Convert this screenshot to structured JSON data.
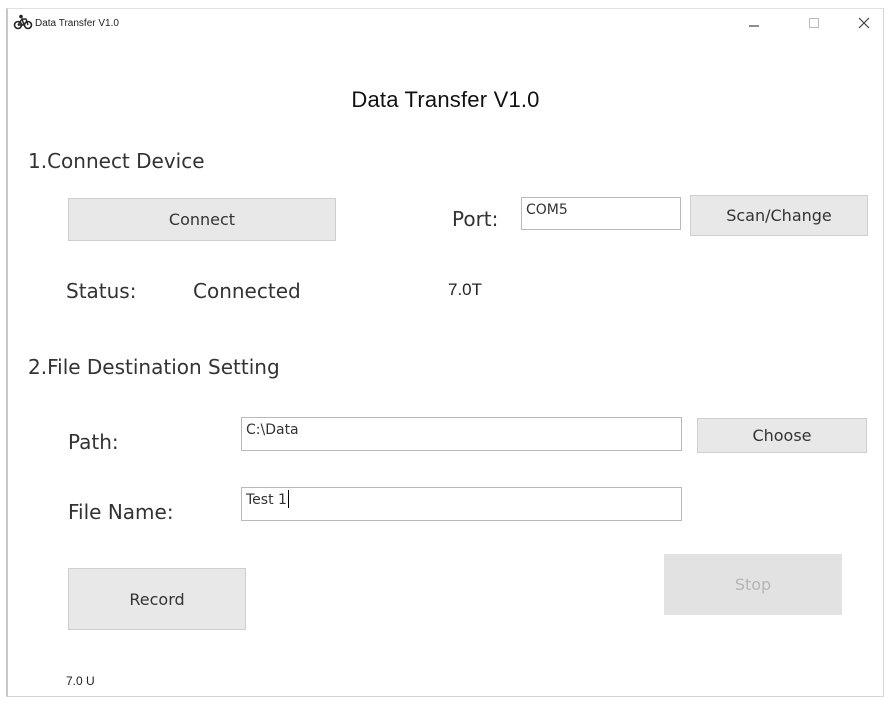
{
  "window": {
    "title": "Data Transfer V1.0",
    "icon": "bicycle-icon",
    "controls": {
      "minimize": "minimize-icon",
      "maximize": "maximize-icon",
      "close": "close-icon"
    }
  },
  "header": {
    "title": "Data Transfer V1.0"
  },
  "connect_section": {
    "title": "1.Connect Device",
    "connect_button": "Connect",
    "port_label": "Port:",
    "port_value": "COM5",
    "scan_button": "Scan/Change",
    "status_label": "Status:",
    "status_value": "Connected",
    "version_note": "7.0T"
  },
  "file_section": {
    "title": "2.File Destination Setting",
    "path_label": "Path:",
    "path_value": "C:\\Data",
    "choose_button": "Choose",
    "filename_label": "File Name:",
    "filename_value": "Test 1"
  },
  "actions": {
    "record_button": "Record",
    "stop_button": "Stop"
  },
  "footer": {
    "version": "7.0 U"
  }
}
